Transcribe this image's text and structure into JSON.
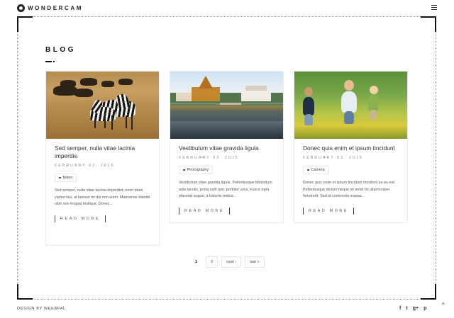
{
  "header": {
    "logo_text": "WONDERCAM"
  },
  "section": {
    "title": "BLOG"
  },
  "posts": [
    {
      "title": "Sed semper, nulla vitae lacinia imperdie",
      "date": "FEBRUARY 03, 2015",
      "tag": "Nikon",
      "excerpt": "Sed semper, nulla vitae lacinia imperdiet, enim diam varius nisi, at laoreet mi dui non enim. Maecenas blandit nibh non feugiat tristique. Donec...",
      "read_more": "READ MORE"
    },
    {
      "title": "Vestibulum vitae gravida ligula",
      "date": "FEBRUARY 03, 2015",
      "tag": "Photography",
      "excerpt": "Vestibulum vitae gravida ligula. Pellentesque bibendum ante iaculis, porta velit non, porttitor urna. Fusce eget placerat augue, a lobortis metus...",
      "read_more": "READ MORE"
    },
    {
      "title": "Donec quis enim et ipsum tincidunt",
      "date": "FEBRUARY 03, 2015",
      "tag": "Camera",
      "excerpt": "Donec quis enim et ipsum tincidunt tincidunt eu eu est. Pellentesque dictum neque sit amet mi ullamcorper hendrerit. Sed id commodo massa...",
      "read_more": "READ MORE"
    }
  ],
  "pagination": {
    "current": "1",
    "page2": "2",
    "next": "next ›",
    "last": "last »"
  },
  "footer": {
    "credit": "DESIGN BY WEEBPAL",
    "social": {
      "facebook": "f",
      "twitter": "t",
      "google_plus": "g+",
      "pinterest": "p"
    },
    "to_top": "^"
  }
}
